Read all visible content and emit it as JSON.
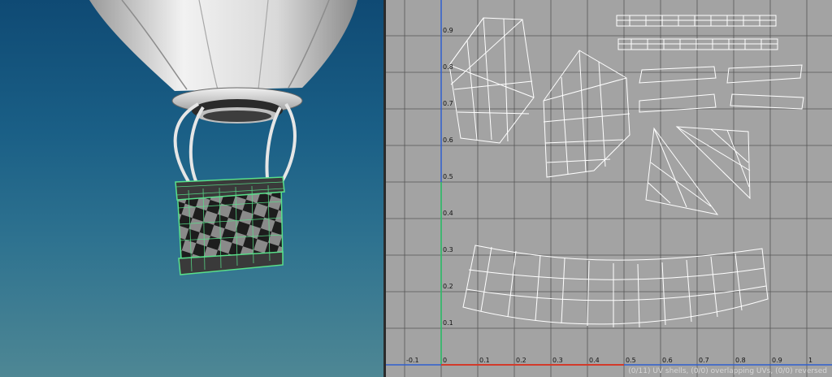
{
  "viewport": {
    "name": "3D perspective viewport",
    "colors": {
      "sky_top": "#0f4a74",
      "sky_bottom": "#4e8794",
      "selection": "#59e08a"
    }
  },
  "uv_editor": {
    "colors": {
      "background": "#a3a3a3",
      "grid": "#555555",
      "u_axis": "#d23a2a",
      "v_axis": "#2f5fd0",
      "wire": "#ffffff"
    },
    "u_ticks": [
      "-0.1",
      "0",
      "0.1",
      "0.2",
      "0.3",
      "0.4",
      "0.5",
      "0.6",
      "0.7",
      "0.8",
      "0.9",
      "1"
    ],
    "v_ticks": [
      "0.1",
      "0.2",
      "0.3",
      "0.4",
      "0.5",
      "0.6",
      "0.7",
      "0.8",
      "0.9"
    ],
    "status": "(0/11) UV shells, (0/0) overlapping UVs, (0/0) reversed"
  }
}
